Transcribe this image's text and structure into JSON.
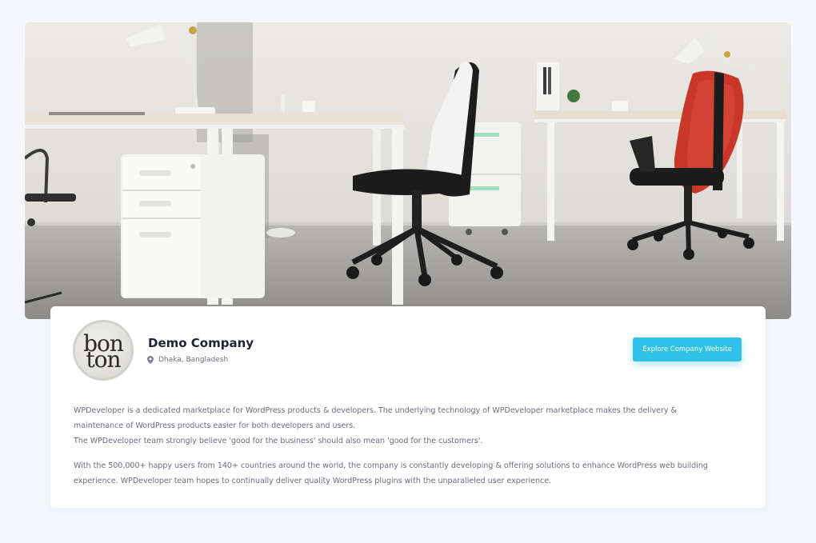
{
  "cover": {
    "alt": "Office interior with desks, chairs and filing cabinets"
  },
  "company": {
    "logo_line1": "bon",
    "logo_line2": "ton",
    "name": "Demo Company",
    "location": "Dhaka, Bangladesh",
    "website_button_label": "Explore Company Website"
  },
  "description": {
    "paragraph1_line1": "WPDeveloper is a dedicated marketplace for WordPress products & developers. The underlying technology of WPDeveloper marketplace makes the delivery &",
    "paragraph1_line2": "maintenance of WordPress products easier for both developers and users.",
    "paragraph1_line3": "The WPDeveloper team strongly believe 'good for the business' should also mean 'good for the customers'.",
    "paragraph2_line1": "With the 500,000+ happy users from 140+ countries around the world, the company is constantly developing & offering solutions to enhance WordPress web building",
    "paragraph2_line2": "experience. WPDeveloper team hopes to continually deliver quality WordPress plugins with the unparalleled user experience."
  },
  "colors": {
    "accent": "#2fc1e6",
    "page_background": "#f5f7fd",
    "card_background": "#ffffff",
    "heading_text": "#1f2333",
    "body_text": "#6a6d7e"
  },
  "icons": {
    "location": "map-pin-icon"
  }
}
